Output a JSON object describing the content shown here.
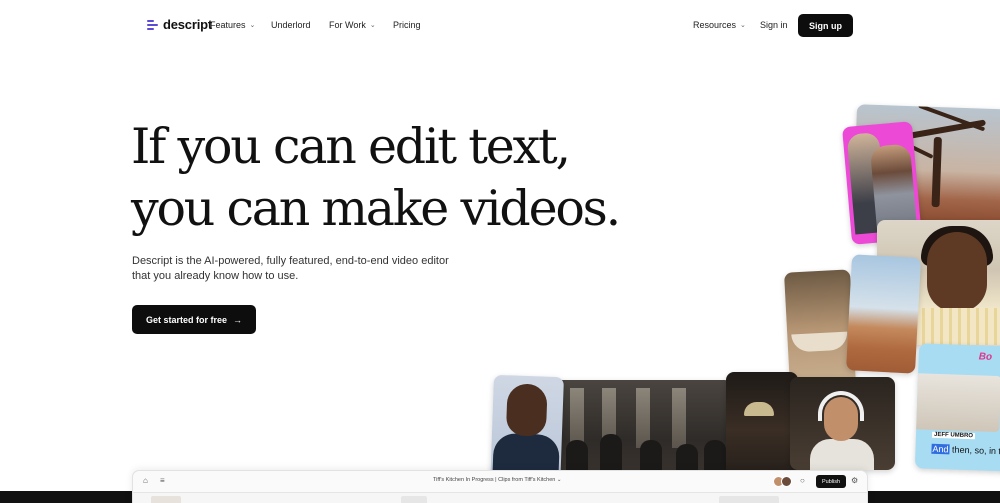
{
  "nav": {
    "logo_text": "descript",
    "items": [
      {
        "label": "Features",
        "has_dropdown": true
      },
      {
        "label": "Underlord",
        "has_dropdown": false
      },
      {
        "label": "For Work",
        "has_dropdown": true
      },
      {
        "label": "Pricing",
        "has_dropdown": false
      }
    ],
    "resources": {
      "label": "Resources",
      "has_dropdown": true
    },
    "sign_in": "Sign in",
    "sign_up": "Sign up",
    "chevron": "⌄"
  },
  "hero": {
    "title_line1": "If you can edit text,",
    "title_line2": "you can make videos.",
    "subtitle_line1": "Descript is the AI-powered, fully featured, end-to-end video editor",
    "subtitle_line2": "that you already know how to use.",
    "cta_label": "Get started for free",
    "cta_arrow": "→"
  },
  "collage": {
    "caption_name": "JEFF UMBRO",
    "caption_highlight": "And",
    "caption_rest": " then, so, in th",
    "caption_tag": "Bo"
  },
  "app_preview": {
    "breadcrumb": "Tiff's Kitchen In Progress  |  Clips from Tiff's Kitchen ⌄",
    "publish_label": "Publish",
    "home_icon": "⌂",
    "menu_icon": "≡",
    "comment_icon": "○",
    "settings_icon": "⚙"
  },
  "colors": {
    "brand": "#5b4bd6",
    "button_dark": "#0d0d0d",
    "caption_highlight": "#2f6de1",
    "pink_card": "#ec4ad6",
    "caption_card": "#a7dcf3"
  }
}
